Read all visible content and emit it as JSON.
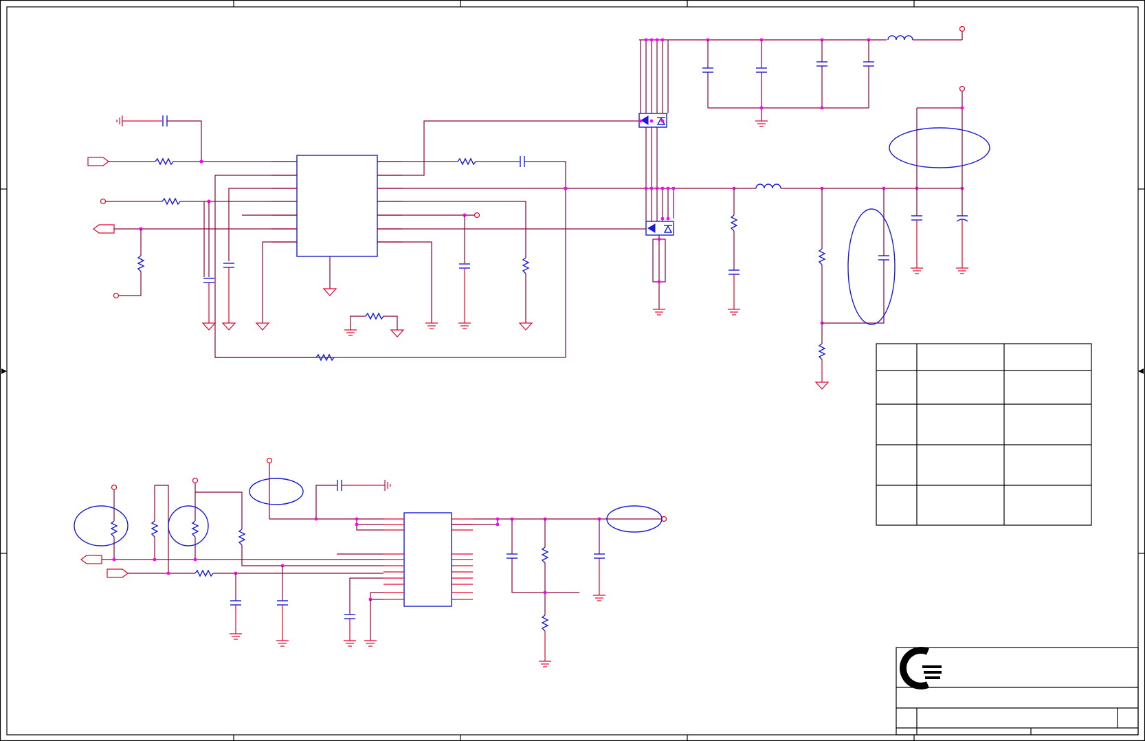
{
  "colors": {
    "wire": "#8a0038",
    "pin": "#e8002a",
    "component": "#1a1ad8",
    "junction": "#ff00ff",
    "border": "#000000"
  },
  "logo": {
    "icon": "company-logo-icon"
  }
}
